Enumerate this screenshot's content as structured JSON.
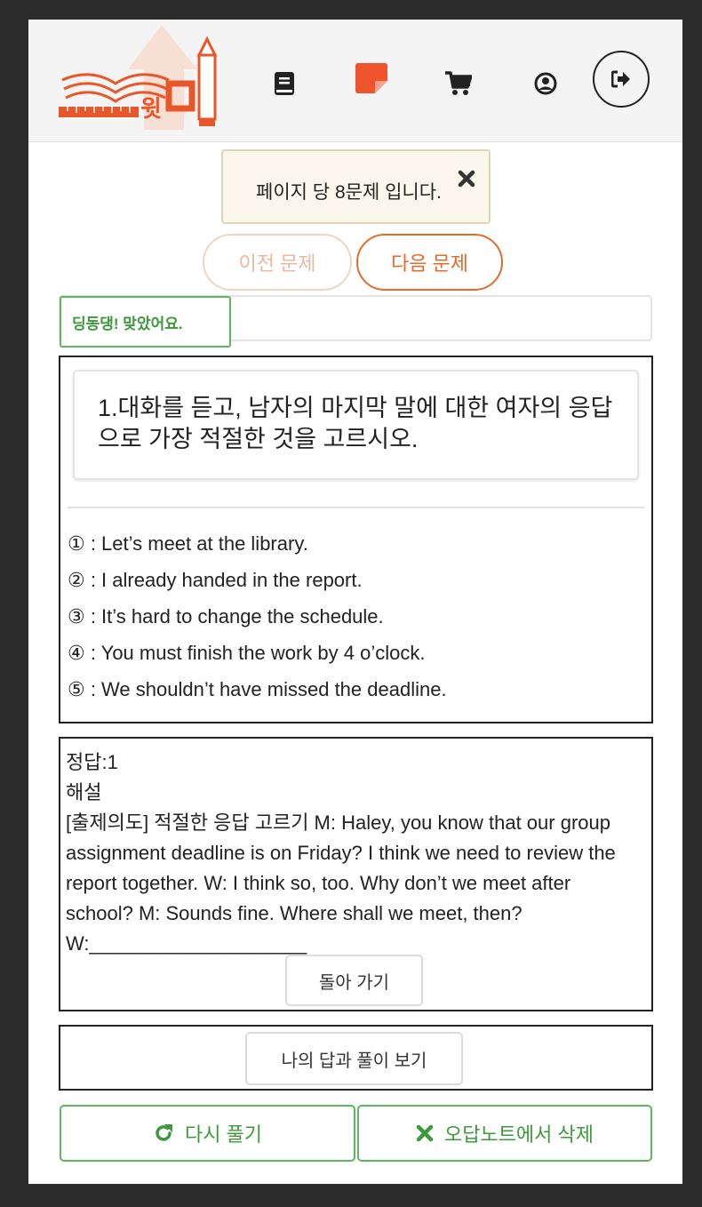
{
  "header": {
    "logo_text": "윗미",
    "nav": [
      {
        "name": "book-icon"
      },
      {
        "name": "note-icon",
        "color": "#f0542c"
      },
      {
        "name": "cart-icon"
      },
      {
        "name": "user-icon"
      },
      {
        "name": "logout-icon"
      }
    ]
  },
  "notice": {
    "text": "페이지 당 8문제 입니다."
  },
  "pager": {
    "prev_label": "이전 문제",
    "next_label": "다음 문제"
  },
  "result": {
    "label": "딩동댕! 맞았어요."
  },
  "question": {
    "text": "1.대화를 듣고, 남자의 마지막 말에 대한 여자의 응답으로 가장 적절한 것을 고르시오.",
    "choices": [
      "① : Let’s meet at the library.",
      "② : I already handed in the report.",
      "③ : It’s hard to change the schedule.",
      "④ : You must finish the work by 4 o’clock.",
      "⑤ : We shouldn’t have missed the deadline."
    ]
  },
  "answer": {
    "correct": "정답:1",
    "explanation_title": "해설",
    "explanation": "[출제의도] 적절한 응답 고르기 M: Haley, you know that our group assignment deadline is on Friday? I think we need to review the report together. W: I think so, too. Why don’t we meet after school? M: Sounds fine. Where shall we meet, then? W:____________________",
    "back_label": "돌아 가기"
  },
  "view_answer_label": "나의 답과 풀이 보기",
  "actions": {
    "retry_label": "다시 풀기",
    "delete_label": "오답노트에서 삭제"
  },
  "colors": {
    "accent_orange": "#e36b2c",
    "accent_green": "#5cb85c",
    "brand_red": "#f0542c"
  }
}
